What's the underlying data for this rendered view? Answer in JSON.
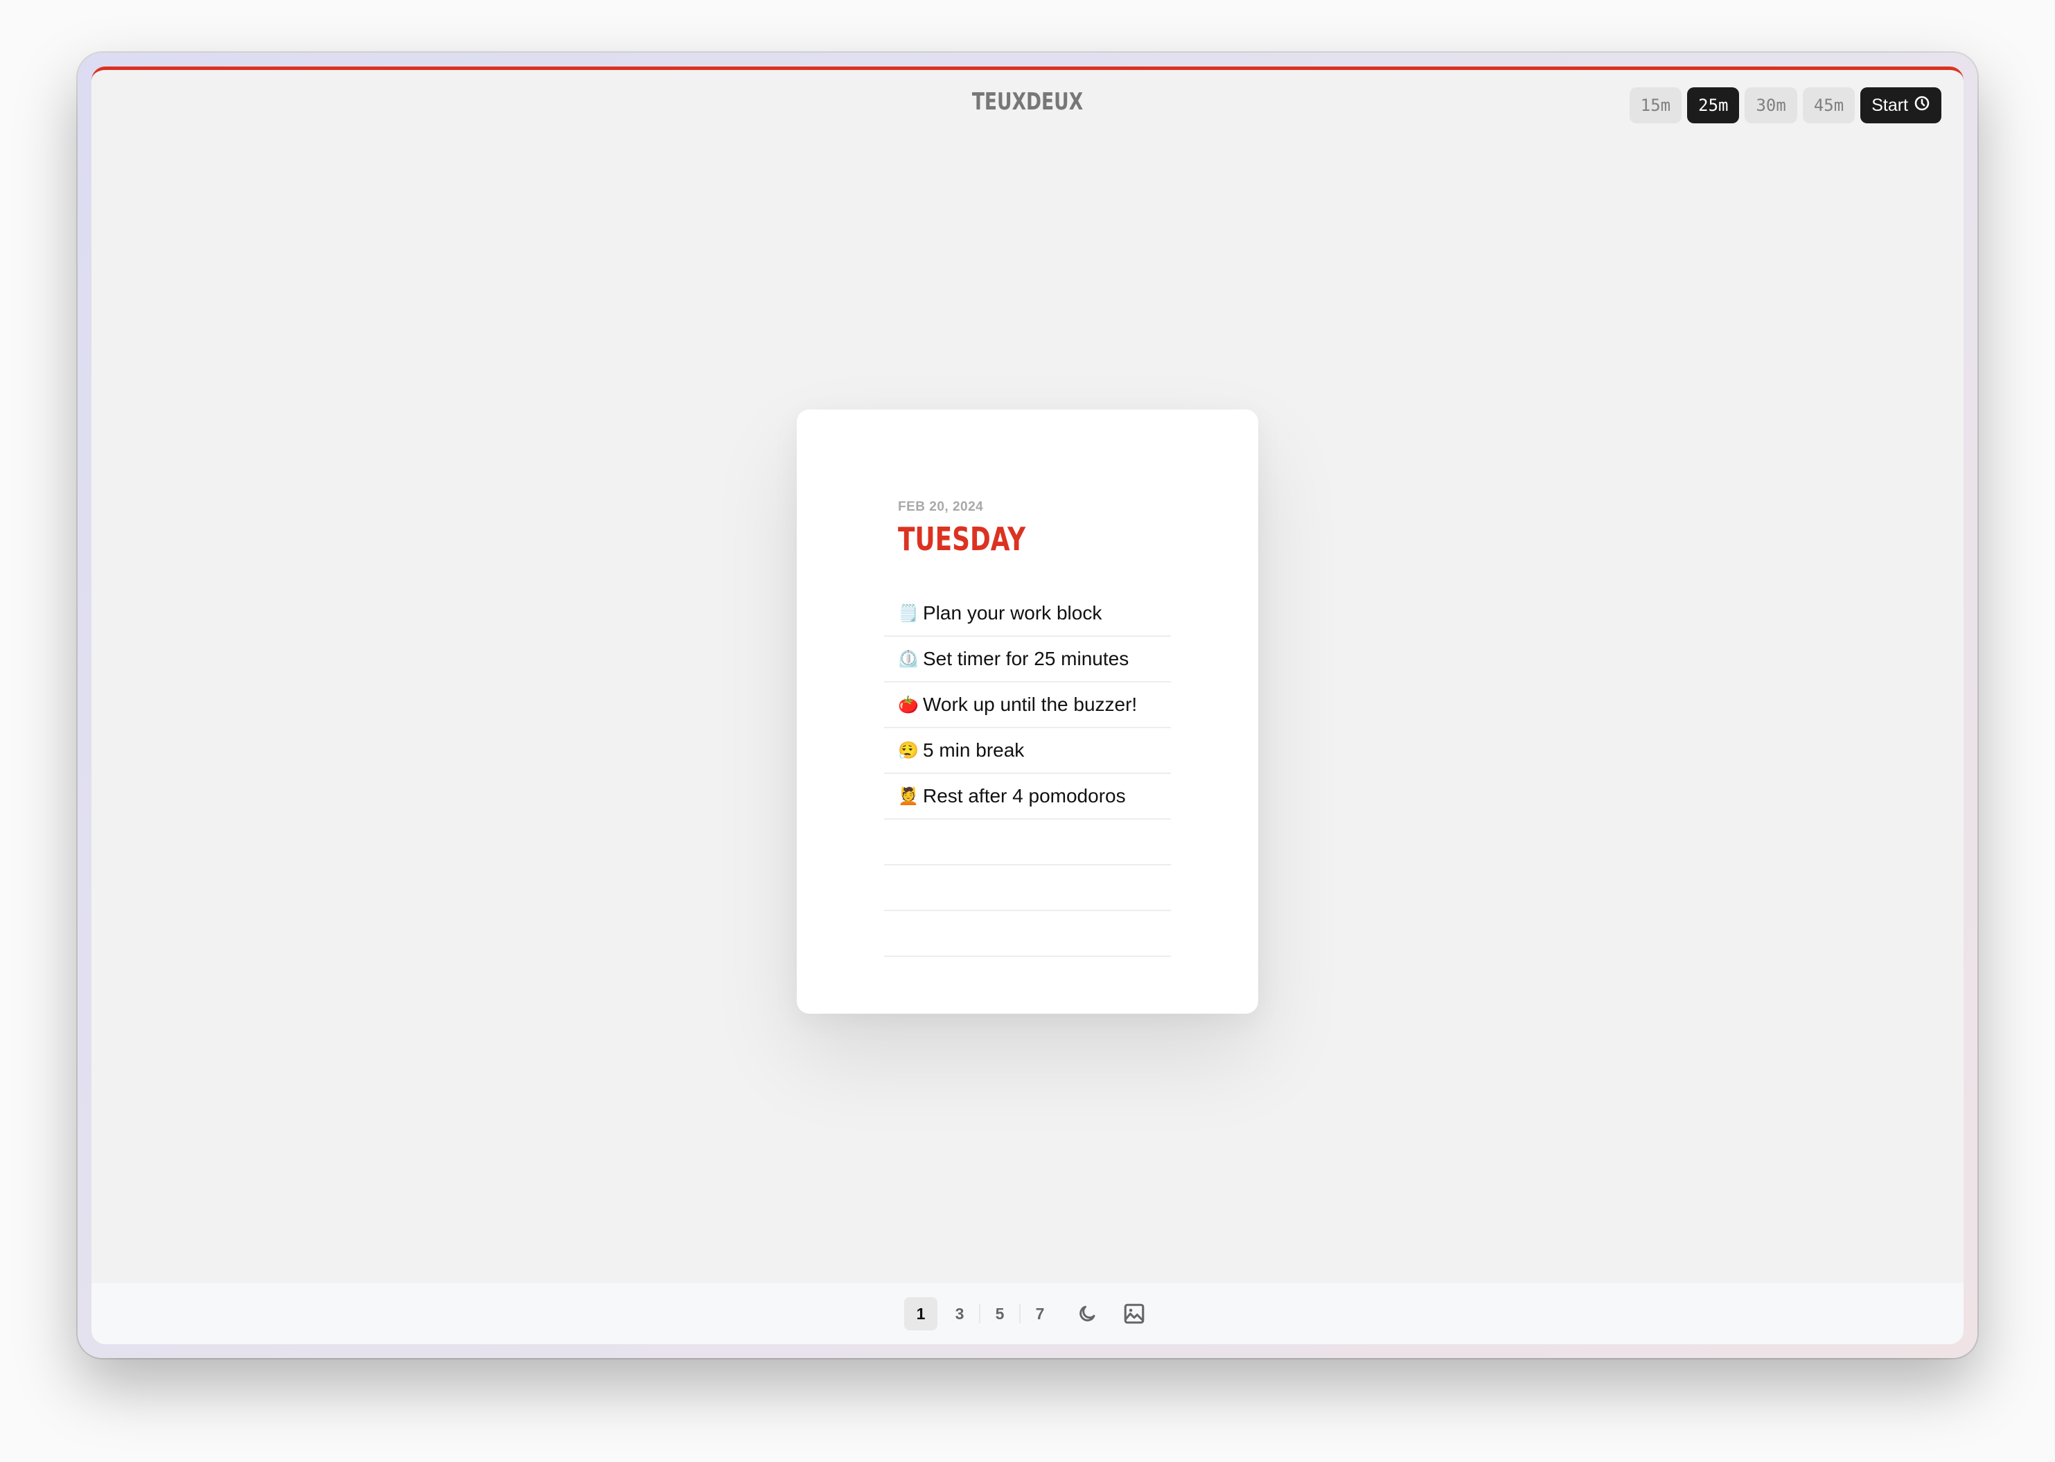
{
  "app": {
    "title": "TEUXDEUX",
    "accent_color": "#dc3221"
  },
  "timer": {
    "options": [
      {
        "label": "15m",
        "active": false
      },
      {
        "label": "25m",
        "active": true
      },
      {
        "label": "30m",
        "active": false
      },
      {
        "label": "45m",
        "active": false
      }
    ],
    "start_label": "Start",
    "start_icon": "clock-icon"
  },
  "card": {
    "date": "FEB 20, 2024",
    "day": "TUESDAY",
    "todos": [
      {
        "emoji": "🗒️",
        "text": "Plan your work block"
      },
      {
        "emoji": "⏲️",
        "text": "Set timer for 25 minutes"
      },
      {
        "emoji": "🍅",
        "text": "Work up until the buzzer!"
      },
      {
        "emoji": "😮‍💨",
        "text": "5 min break"
      },
      {
        "emoji": "💆",
        "text": "Rest after 4 pomodoros"
      },
      {
        "emoji": "",
        "text": ""
      },
      {
        "emoji": "",
        "text": ""
      },
      {
        "emoji": "",
        "text": ""
      }
    ]
  },
  "bottom_bar": {
    "column_options": [
      {
        "label": "1",
        "active": true
      },
      {
        "label": "3",
        "active": false
      },
      {
        "label": "5",
        "active": false
      },
      {
        "label": "7",
        "active": false
      }
    ],
    "dark_mode_icon": "moon-icon",
    "background_icon": "image-icon"
  }
}
